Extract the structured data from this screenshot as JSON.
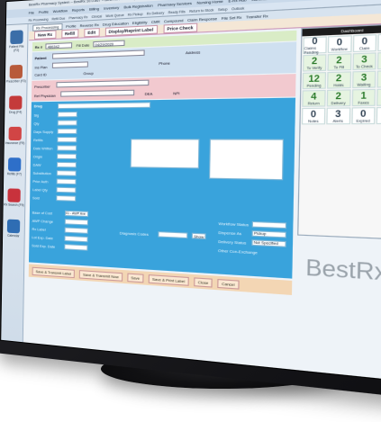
{
  "window": {
    "title": "BestRx Pharmacy System – BestRx 10.0.867 – Best Rx Pharmacy",
    "menus": [
      "File",
      "Profile",
      "Workflow",
      "Reports",
      "Billing",
      "Inventory",
      "Bulk Registration",
      "Pharmacy Services",
      "Nursing Home",
      "E-Rx Hub",
      "Administration",
      "ICare Hub",
      "Help",
      "Shop",
      "Exit"
    ],
    "toolbar": [
      "Rx Processing",
      "Refill Due",
      "Pharmacy Rx",
      "Clinical",
      "Work Queue",
      "Rx Pickup",
      "Rx Delivery",
      "Ready Fills",
      "Return to Stock",
      "Setup",
      "Outlook"
    ]
  },
  "sidebar": {
    "items": [
      {
        "label": "Patient File (F2)",
        "icon": "patient-icon",
        "color": "#3b6ea8"
      },
      {
        "label": "Prescriber (F3)",
        "icon": "prescriber-icon",
        "color": "#b85a3a"
      },
      {
        "label": "Drug (F4)",
        "icon": "drug-icon",
        "color": "#c43a3a"
      },
      {
        "label": "Insurance (F5)",
        "icon": "insurance-icon",
        "color": "#d14545"
      },
      {
        "label": "Refills (F7)",
        "icon": "refill-icon",
        "color": "#2e6fc9"
      },
      {
        "label": "Rx Search (F9)",
        "icon": "search-icon",
        "color": "#c8323c"
      },
      {
        "label": "Calendar",
        "icon": "calendar-icon",
        "color": "#2f6db3"
      }
    ]
  },
  "tabs": [
    "Rx Processing",
    "Profile",
    "Reverse Rx",
    "Drug Education",
    "Eligibility",
    "CMR",
    "Compound",
    "Claim Response",
    "File Set Rx",
    "Transfer Rx"
  ],
  "actions": [
    "New Rx",
    "Refill",
    "Edit",
    "Display/Reprint Label",
    "Price Check"
  ],
  "rx": {
    "label": "Rx #",
    "number": "486342",
    "fill_date_label": "Fill Date",
    "fill_date": "04/29/2020"
  },
  "patient": {
    "label": "Patient",
    "ins_plan_label": "Ins Plan",
    "card_id_label": "Card ID",
    "address_label": "Address",
    "phone_label": "Phone",
    "group_label": "Group"
  },
  "prescriber": {
    "label": "Prescriber",
    "ref_label": "Ref Physician",
    "dea_label": "DEA",
    "npi_label": "NPI"
  },
  "drug": {
    "label": "Drug",
    "fields": [
      "Sig",
      "Qty",
      "Days Supply",
      "Refills",
      "Date Written",
      "Origin",
      "DAW",
      "Substitution",
      "Prior Auth",
      "Label Qty",
      "Sold"
    ],
    "lower_fields": [
      "Base of Cost",
      "AWP Change",
      "Rx Label",
      "Lot Exp. Date",
      "Sold Exp. Date"
    ],
    "base_of_cost_value": "01 - AWP Ave",
    "diagnosis_label": "Diagnosis Codes",
    "show_button": "Show",
    "workflow_label": "Workflow Status",
    "dispense_label": "Dispense As",
    "dispense_value": "Pickup",
    "delivery_label": "Delivery Status",
    "delivery_value": "Not Specified",
    "other_label": "Other Con-Exchange"
  },
  "bottom_buttons": [
    "Save & Transmit Label",
    "Save & Transmit Now",
    "Save",
    "Save & Print Label",
    "Close",
    "Cancel"
  ],
  "dashboard": {
    "title": "Dashboard",
    "cells": [
      {
        "label": "Claims Pending",
        "value": "0"
      },
      {
        "label": "Workflow",
        "value": "0"
      },
      {
        "label": "Claim",
        "value": "0"
      },
      {
        "label": "Refill Due",
        "value": "0"
      },
      {
        "label": "To Verify",
        "value": "2",
        "highlight": true
      },
      {
        "label": "To Fill",
        "value": "2",
        "highlight": true
      },
      {
        "label": "To Check",
        "value": "3",
        "highlight": true
      },
      {
        "label": "Picked",
        "value": "8",
        "highlight": true
      },
      {
        "label": "Pending",
        "value": "12",
        "highlight": true
      },
      {
        "label": "Holds",
        "value": "2",
        "highlight": true
      },
      {
        "label": "Waiting",
        "value": "3",
        "highlight": true
      },
      {
        "label": "Sync",
        "value": "2",
        "highlight": true
      },
      {
        "label": "Return",
        "value": "4",
        "highlight": true
      },
      {
        "label": "Delivery",
        "value": "2",
        "highlight": true
      },
      {
        "label": "Faxes",
        "value": "1",
        "highlight": true
      },
      {
        "label": "eRx",
        "value": "5",
        "highlight": true
      },
      {
        "label": "Notes",
        "value": "0"
      },
      {
        "label": "Alerts",
        "value": "3"
      },
      {
        "label": "Expired",
        "value": "0"
      },
      {
        "label": "Total",
        "value": "0"
      }
    ]
  },
  "logo": "BestRx"
}
